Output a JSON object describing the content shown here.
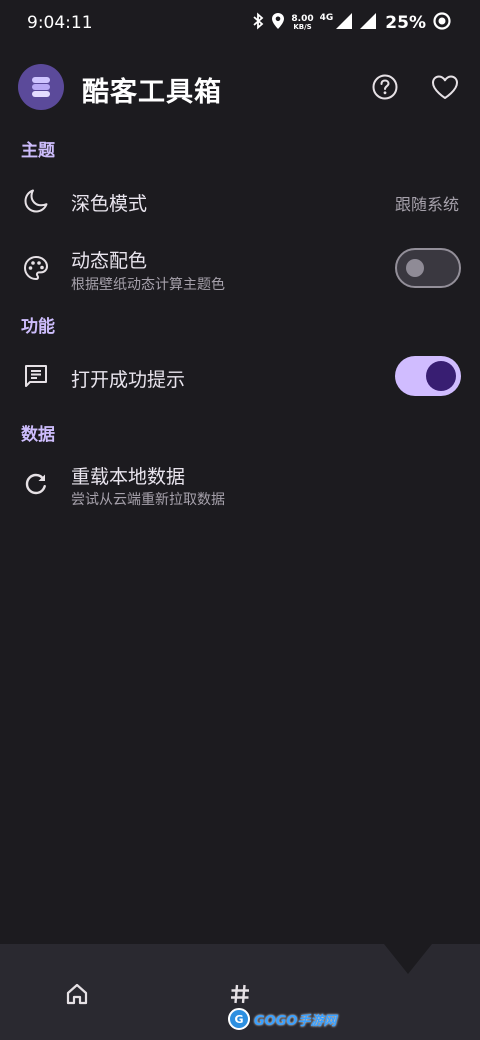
{
  "status_bar": {
    "time": "9:04:11",
    "speed_value": "8.00",
    "speed_unit": "KB/S",
    "network": "4G",
    "battery": "25%"
  },
  "app_bar": {
    "title": "酷客工具箱",
    "logo_color": "#5b4a9a",
    "icons": [
      "help-icon",
      "heart-icon"
    ]
  },
  "sections": {
    "theme": {
      "header": "主题",
      "dark_mode": {
        "title": "深色模式",
        "value": "跟随系统",
        "icon": "moon-icon"
      },
      "dynamic_color": {
        "title": "动态配色",
        "subtitle": "根据壁纸动态计算主题色",
        "icon": "palette-icon",
        "enabled": false
      }
    },
    "features": {
      "header": "功能",
      "open_success_tip": {
        "title": "打开成功提示",
        "icon": "message-icon",
        "enabled": true
      }
    },
    "data": {
      "header": "数据",
      "reload_local_data": {
        "title": "重载本地数据",
        "subtitle": "尝试从云端重新拉取数据",
        "icon": "refresh-icon"
      }
    }
  },
  "bottom_nav": {
    "items": [
      {
        "icon": "home-icon"
      },
      {
        "icon": "hash-icon"
      }
    ]
  },
  "watermark": {
    "text": "GOGO手游网"
  },
  "colors": {
    "background": "#1c1b1f",
    "accent": "#cdbdfc",
    "switch_on_track": "#d0bcff",
    "switch_on_knob": "#381e72"
  }
}
